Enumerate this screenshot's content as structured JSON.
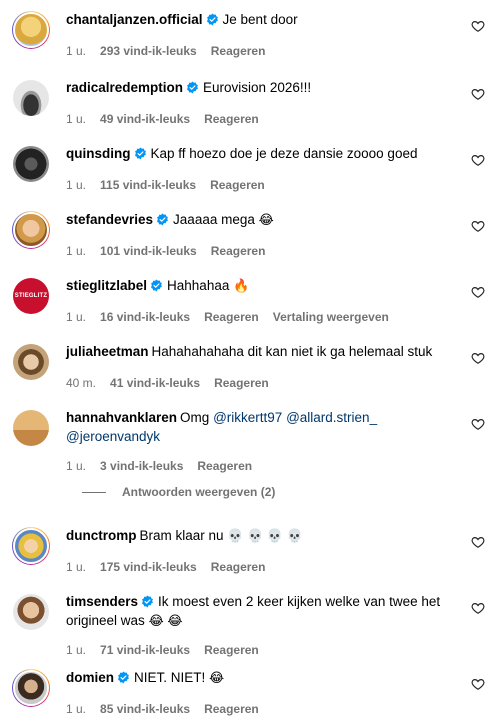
{
  "comments": [
    {
      "user": "chantaljanzen.official",
      "verified": true,
      "text": "Je bent door",
      "emoji": "",
      "time": "1 u.",
      "likes": "293 vind-ik-leuks",
      "reply": "Reageren",
      "translate": ""
    },
    {
      "user": "radicalredemption",
      "verified": true,
      "text": "Eurovision 2026!!!",
      "emoji": "",
      "time": "1 u.",
      "likes": "49 vind-ik-leuks",
      "reply": "Reageren",
      "translate": ""
    },
    {
      "user": "quinsding",
      "verified": true,
      "text": "Kap ff hoezo doe je deze dansie zoooo goed",
      "emoji": "",
      "time": "1 u.",
      "likes": "115 vind-ik-leuks",
      "reply": "Reageren",
      "translate": ""
    },
    {
      "user": "stefandevries",
      "verified": true,
      "text": "Jaaaaa mega",
      "emoji": "😂",
      "time": "1 u.",
      "likes": "101 vind-ik-leuks",
      "reply": "Reageren",
      "translate": ""
    },
    {
      "user": "stieglitzlabel",
      "verified": true,
      "text": "Hahhahaa",
      "emoji": "🔥",
      "time": "1 u.",
      "likes": "16 vind-ik-leuks",
      "reply": "Reageren",
      "translate": "Vertaling weergeven"
    },
    {
      "user": "juliaheetman",
      "verified": false,
      "text": "Hahahahahaha dit kan niet ik ga helemaal stuk",
      "emoji": "",
      "time": "40 m.",
      "likes": "41 vind-ik-leuks",
      "reply": "Reageren",
      "translate": ""
    },
    {
      "user": "hannahvanklaren",
      "verified": false,
      "text": "Omg",
      "mentions": [
        "@rikkertt97",
        "@allard.strien_",
        "@jeroenvandyk"
      ],
      "emoji": "",
      "time": "1 u.",
      "likes": "3 vind-ik-leuks",
      "reply": "Reageren",
      "translate": ""
    },
    {
      "user": "dunctromp",
      "verified": false,
      "text": "Bram klaar nu",
      "emoji": "💀 💀 💀 💀",
      "time": "1 u.",
      "likes": "175 vind-ik-leuks",
      "reply": "Reageren",
      "translate": ""
    },
    {
      "user": "timsenders",
      "verified": true,
      "text": "Ik moest even 2 keer kijken welke van twee het origineel was",
      "emoji": "😂 😂",
      "time": "1 u.",
      "likes": "71 vind-ik-leuks",
      "reply": "Reageren",
      "translate": ""
    },
    {
      "user": "domien",
      "verified": true,
      "text": "NIET. NIET!",
      "emoji": "😂",
      "time": "1 u.",
      "likes": "85 vind-ik-leuks",
      "reply": "Reageren",
      "translate": ""
    }
  ],
  "view_replies": "Antwoorden weergeven (2)",
  "icons": {
    "verified": "verified-badge-icon",
    "like": "heart-icon"
  },
  "colors": {
    "verified": "#0095f6",
    "mention": "#00376b",
    "meta": "#737373"
  }
}
